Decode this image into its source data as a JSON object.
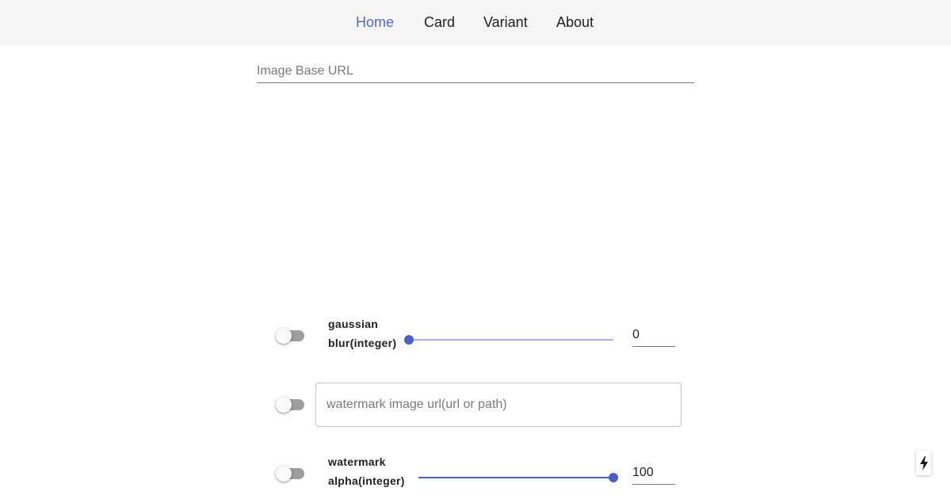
{
  "nav": {
    "items": [
      {
        "label": "Home",
        "active": true
      },
      {
        "label": "Card",
        "active": false
      },
      {
        "label": "Variant",
        "active": false
      },
      {
        "label": "About",
        "active": false
      }
    ],
    "active_color": "#5468c8"
  },
  "image_base_url": {
    "placeholder": "Image Base URL",
    "value": ""
  },
  "controls": {
    "gaussian_blur": {
      "label_line1": "gaussian",
      "label_line2": "blur(integer)",
      "enabled": false,
      "slider_fraction": 0,
      "value": "0"
    },
    "watermark_image": {
      "enabled": false,
      "placeholder": "watermark image url(url or path)",
      "value": ""
    },
    "watermark_alpha": {
      "label_line1": "watermark",
      "label_line2": "alpha(integer)",
      "enabled": false,
      "slider_fraction": 1,
      "value": "100"
    }
  },
  "corner_button": {
    "icon": "lightning-bolt-icon"
  },
  "colors": {
    "accent": "#4b5fc4",
    "nav_background": "#f5f5f5",
    "switch_off_track": "#9e9e9e"
  }
}
